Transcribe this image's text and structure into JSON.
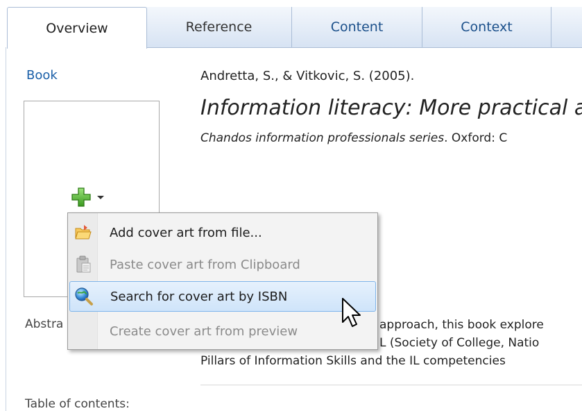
{
  "tabs": [
    {
      "label": "Overview",
      "active": true
    },
    {
      "label": "Reference"
    },
    {
      "label": "Content"
    },
    {
      "label": "Context"
    }
  ],
  "reference": {
    "type": "Book",
    "authors": "Andretta, S., & Vitkovic, S. (2005).",
    "title": "Information literacy: More practical a",
    "series_italic": "Chandos information professionals series",
    "series_rest": ". Oxford: C"
  },
  "abstract": {
    "label": "Abstra",
    "lines": [
      "approach, this book explore",
      "L (Society of College, Natio",
      "Pillars of Information Skills and the IL competencies"
    ]
  },
  "toc_label": "Table of contents:",
  "cover_menu": {
    "items": [
      {
        "label": "Add cover art from file...",
        "icon": "folder-open-icon",
        "enabled": true
      },
      {
        "label": "Paste cover art from Clipboard",
        "icon": "clipboard-icon",
        "enabled": false
      },
      {
        "label": "Search for cover art by ISBN",
        "icon": "search-globe-icon",
        "enabled": true,
        "highlighted": true
      },
      {
        "label": "Create cover art from preview",
        "icon": "",
        "enabled": false
      }
    ]
  },
  "colors": {
    "link": "#1a5fa8",
    "tab_text": "#1a4f8a",
    "menu_highlight_border": "#7eb4ea"
  }
}
